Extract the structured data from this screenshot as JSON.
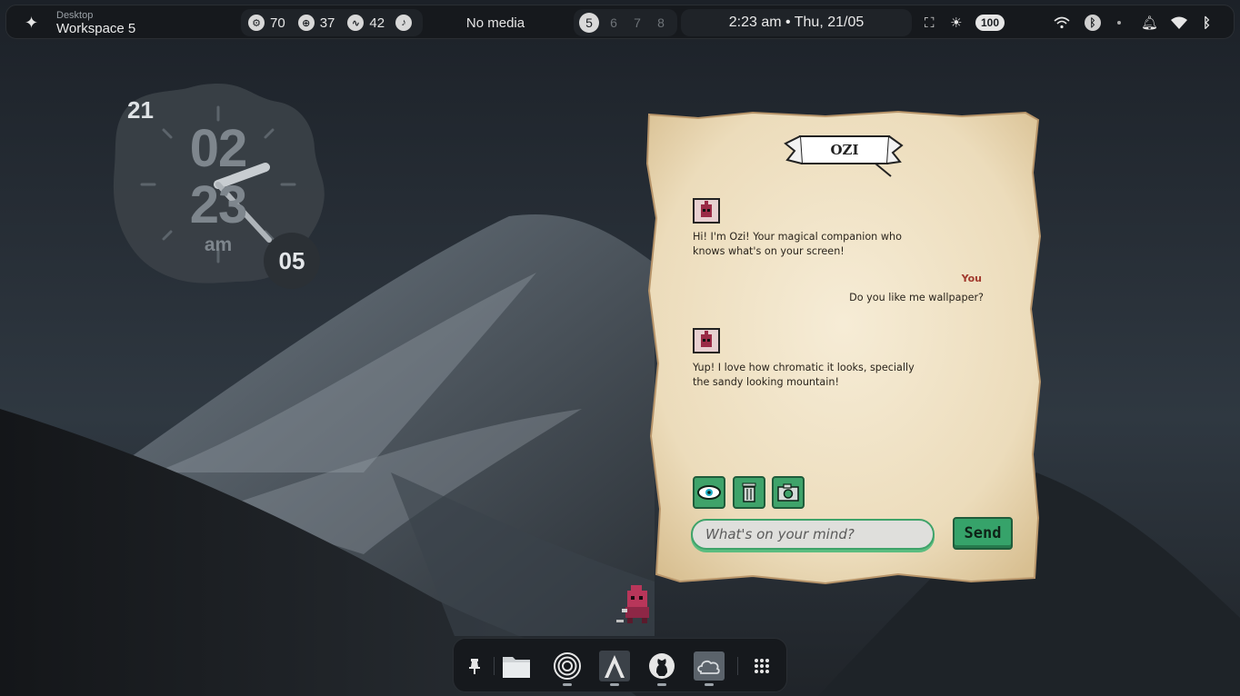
{
  "topbar": {
    "workspace_small": "Desktop",
    "workspace_big": "Workspace 5",
    "stats": [
      {
        "icon": "cpu-icon",
        "value": "70"
      },
      {
        "icon": "memory-icon",
        "value": "37"
      },
      {
        "icon": "activity-icon",
        "value": "42"
      }
    ],
    "media_text": "No media",
    "workspaces": [
      "5",
      "6",
      "7",
      "8"
    ],
    "active_workspace": "5",
    "datetime": "2:23 am • Thu, 21/05",
    "brightness": "100"
  },
  "clock": {
    "date": "21",
    "hour": "02",
    "minute": "23",
    "ampm": "am",
    "seconds": "05"
  },
  "chat": {
    "title": "OZI",
    "messages": [
      {
        "from": "bot",
        "text": "Hi! I'm Ozi! Your magical companion who knows what's on your screen!"
      },
      {
        "from": "user",
        "label": "You",
        "text": "Do you like me wallpaper?"
      },
      {
        "from": "bot",
        "text": "Yup! I love how chromatic it looks, specially the sandy looking mountain!"
      }
    ],
    "tools": [
      "eye-icon",
      "trash-icon",
      "camera-icon"
    ],
    "input_placeholder": "What's on your mind?",
    "send_label": "Send"
  },
  "dock": {
    "items": [
      "pin-icon",
      "files-icon",
      "radar-icon",
      "arch-icon",
      "github-icon",
      "cloud-icon",
      "apps-grid-icon"
    ]
  },
  "colors": {
    "accent_green": "#36a36a",
    "you_label": "#a1392d",
    "paper": "#efe0c2"
  }
}
